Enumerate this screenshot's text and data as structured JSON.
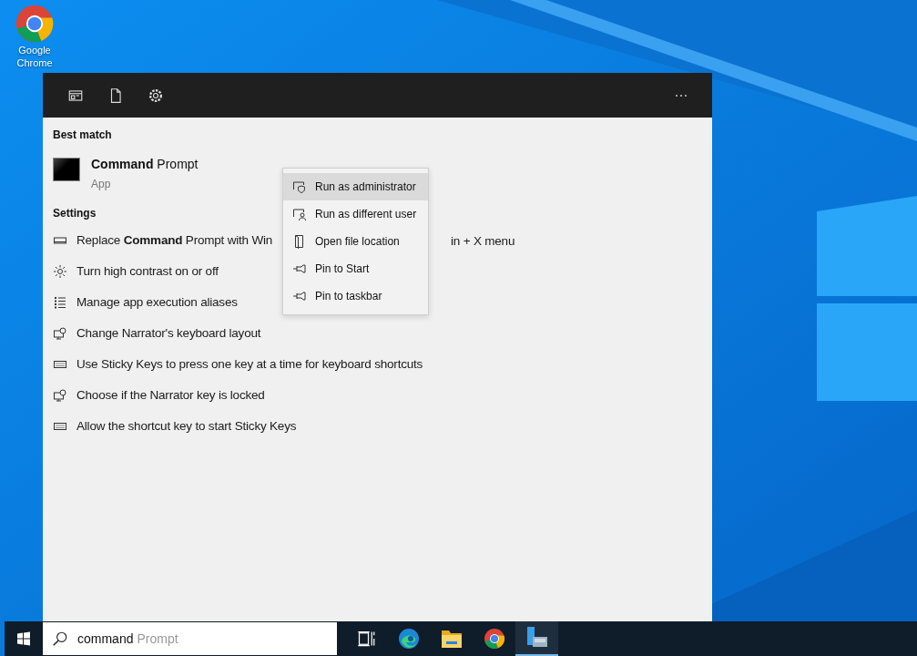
{
  "desktop_icons": [
    {
      "label": "Google Chrome",
      "kind": "chrome"
    }
  ],
  "search_panel": {
    "header_icons": [
      {
        "kind": "tabs"
      },
      {
        "kind": "document"
      },
      {
        "kind": "settings"
      }
    ],
    "best_match": {
      "heading": "Best match",
      "title": "**Command** Prompt",
      "subtitle": "App"
    },
    "settings": {
      "heading": "Settings",
      "items": [
        {
          "kind": "display",
          "label": "Replace **Command** Prompt with Win",
          "label_after_menu": "in + X menu"
        },
        {
          "kind": "brightness",
          "label": "Turn high contrast on or off"
        },
        {
          "kind": "list",
          "label": "Manage app execution aliases"
        },
        {
          "kind": "narrator",
          "label": "Change Narrator's keyboard layout"
        },
        {
          "kind": "keyboard",
          "label": "Use Sticky Keys to press one key at a time for keyboard shortcuts"
        },
        {
          "kind": "narrator",
          "label": "Choose if the Narrator key is locked"
        },
        {
          "kind": "keyboard",
          "label": "Allow the shortcut key to start Sticky Keys"
        }
      ]
    }
  },
  "context_menu": [
    {
      "kind": "shield",
      "label": "Run as administrator",
      "selected": true
    },
    {
      "kind": "user",
      "label": "Run as different user",
      "selected": false
    },
    {
      "kind": "folder",
      "label": "Open file location",
      "selected": false
    },
    {
      "kind": "pin",
      "label": "Pin to Start",
      "selected": false
    },
    {
      "kind": "pin",
      "label": "Pin to taskbar",
      "selected": false
    }
  ],
  "taskbar": {
    "search": {
      "value": "command",
      "suggestion": "Prompt"
    },
    "apps": [
      {
        "kind": "taskview",
        "running": false
      },
      {
        "kind": "edge",
        "running": false
      },
      {
        "kind": "folder",
        "running": false
      },
      {
        "kind": "chrome",
        "running": false
      },
      {
        "kind": "server",
        "running": true
      }
    ]
  }
}
